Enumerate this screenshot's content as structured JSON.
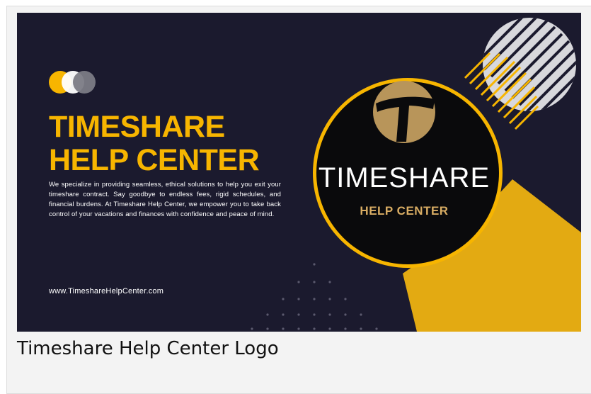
{
  "image": {
    "brand_line_1": "TIMESHARE",
    "brand_line_2": "HELP CENTER",
    "description": "We specialize in providing seamless, ethical solutions to help you exit your timeshare contract. Say goodbye to endless fees, rigid schedules, and financial burdens. At Timeshare Help Center, we empower you to take back control of your vacations and finances with confidence and peace of mind.",
    "website": "www.TimeshareHelpCenter.com",
    "logo_text_main": "TIMESHARE",
    "logo_text_sub": "HELP CENTER",
    "logo_letter": "T"
  },
  "caption": "Timeshare Help Center Logo",
  "colors": {
    "background": "#1b1a2e",
    "accent": "#f7b500",
    "logo_gold": "#b8955a",
    "caption_bg": "#f3f3f3"
  }
}
